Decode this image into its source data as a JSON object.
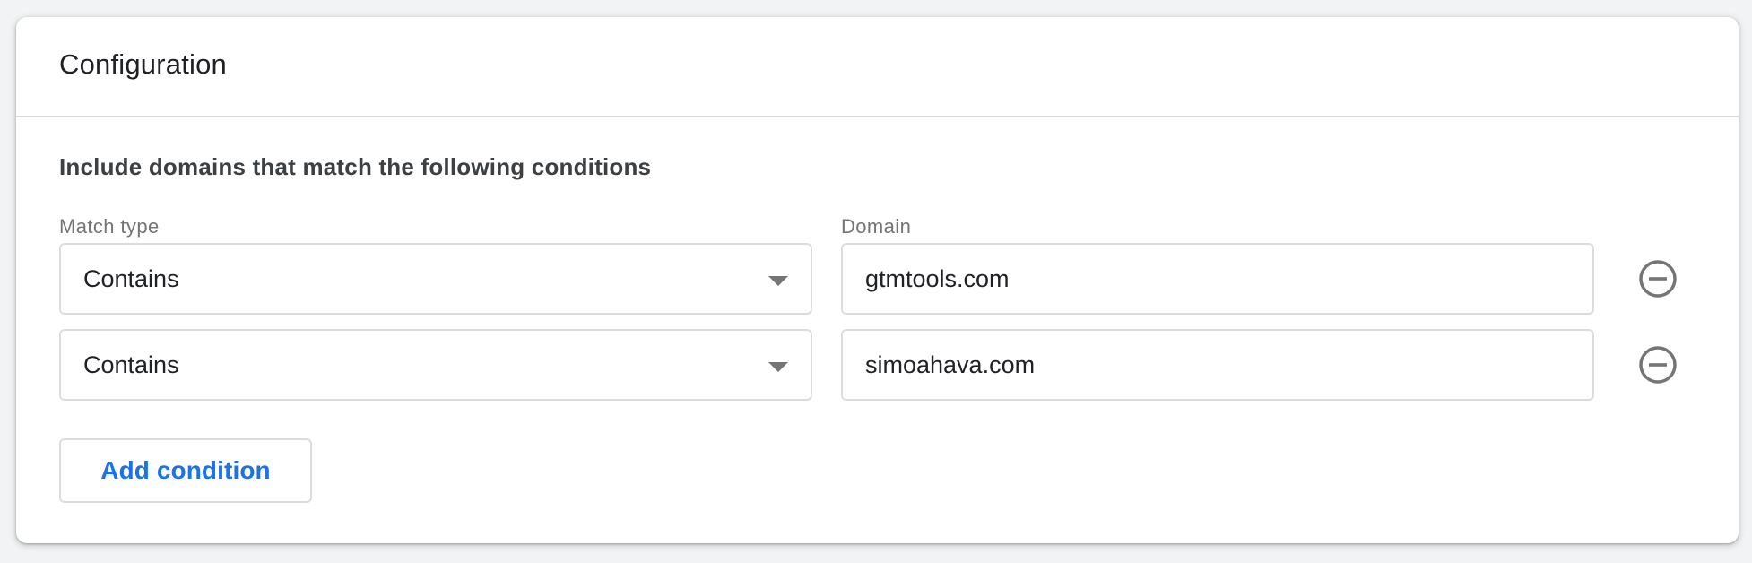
{
  "card": {
    "title": "Configuration"
  },
  "section": {
    "heading": "Include domains that match the following conditions",
    "match_type_label": "Match type",
    "domain_label": "Domain"
  },
  "conditions": [
    {
      "match_type": "Contains",
      "domain": "gtmtools.com"
    },
    {
      "match_type": "Contains",
      "domain": "simoahava.com"
    }
  ],
  "actions": {
    "add_condition_label": "Add condition"
  },
  "icons": {
    "dropdown": "chevron-down-icon",
    "remove": "remove-circle-icon"
  },
  "colors": {
    "accent": "#1a73e8",
    "border": "#dadce0",
    "icon": "#757575",
    "text": "#202124"
  }
}
